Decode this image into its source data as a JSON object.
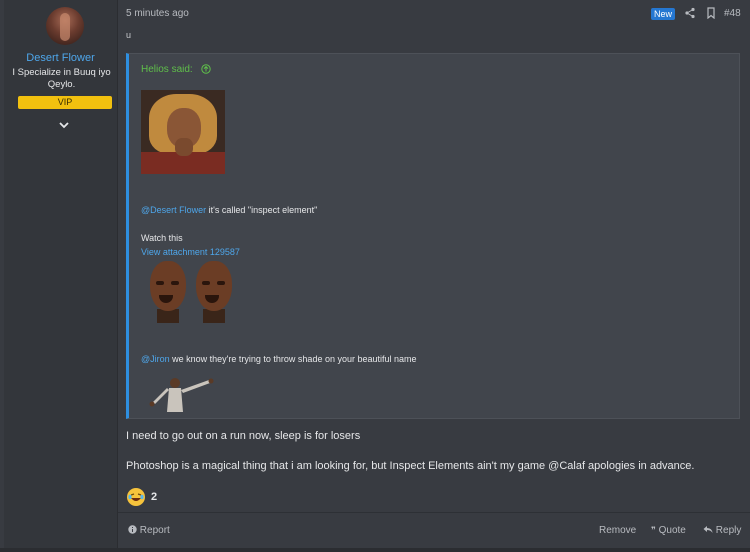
{
  "author": {
    "name": "Desert Flower",
    "title": "I Specialize in Buuq iyo Qeylo.",
    "badge": "VIP"
  },
  "post": {
    "time": "5 minutes ago",
    "new_label": "New",
    "number": "#48",
    "tiny_char": "u",
    "quote": {
      "header": "Helios said:",
      "line1_mention": "@Desert Flower",
      "line1_text": " it's called \"inspect element\"",
      "watch": "Watch this",
      "attachment": "View attachment 129587",
      "line2_mention": "@Jiron",
      "line2_text": " we know they're trying to throw shade on your beautiful name"
    },
    "body1": "I need to go out on a run now, sleep is for losers",
    "body2": "Photoshop is a magical thing that i am looking for, but Inspect Elements ain't my game @Calaf apologies in advance.",
    "reaction_count": "2"
  },
  "footer": {
    "report": "Report",
    "remove": "Remove",
    "quote": "Quote",
    "reply": "Reply"
  },
  "colors": {
    "accent": "#2e8fe0",
    "link": "#4ea6ea",
    "vip": "#f2c10f",
    "quote_header": "#5fbf4a"
  }
}
